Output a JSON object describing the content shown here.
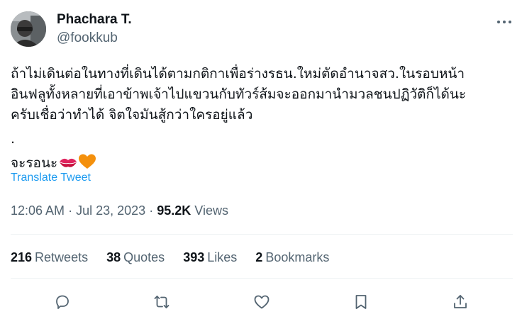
{
  "user": {
    "display_name": "Phachara T.",
    "handle": "@fookkub"
  },
  "tweet": {
    "lines": [
      "ถ้าไม่เดินต่อในทางที่เดินได้ตามกติกาเพื่อร่างรธน.ใหม่ตัดอำนาจสว.ในรอบหน้า",
      "อินฟลูทั้งหลายที่เอาข้าพเจ้าไปแขวนกับทัวร์ส้มจะออกมานำมวลชนปฏิวัติก็ได้นะ",
      "ครับเชื่อว่าทำได้ จิตใจมันสู้กว่าใครอยู่แล้ว",
      ".",
      "จะรอนะ"
    ],
    "emojis": [
      "kiss-mark",
      "orange-heart"
    ],
    "translate_label": "Translate Tweet"
  },
  "meta": {
    "time": "12:06 AM",
    "separator": "·",
    "date": "Jul 23, 2023",
    "views_count": "95.2K",
    "views_label": "Views"
  },
  "stats": {
    "retweets": {
      "count": "216",
      "label": "Retweets"
    },
    "quotes": {
      "count": "38",
      "label": "Quotes"
    },
    "likes": {
      "count": "393",
      "label": "Likes"
    },
    "bookmarks": {
      "count": "2",
      "label": "Bookmarks"
    }
  },
  "icons": {
    "more": "more-icon",
    "reply": "reply-icon",
    "retweet": "retweet-icon",
    "like": "heart-icon",
    "bookmark": "bookmark-icon",
    "share": "share-icon"
  },
  "colors": {
    "text": "#0f1419",
    "secondary": "#536471",
    "link": "#1d9bf0",
    "divider": "#eff3f4",
    "kiss": "#e0245e",
    "heart": "#f4900c"
  }
}
